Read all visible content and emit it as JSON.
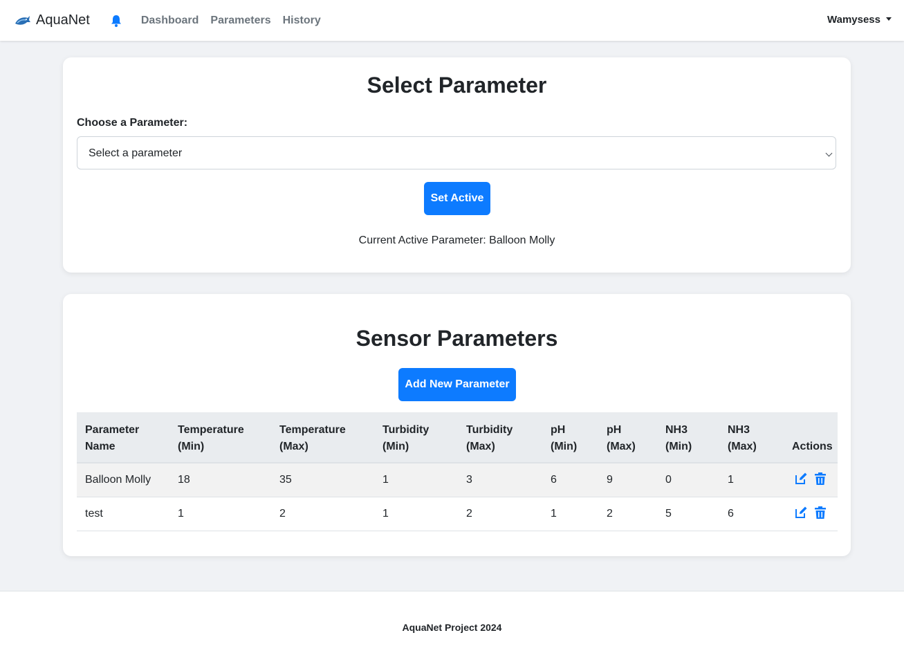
{
  "navbar": {
    "brand": "AquaNet",
    "logo_icon": "fish-logo-icon",
    "notification_icon": "bell-icon",
    "links": [
      "Dashboard",
      "Parameters",
      "History"
    ],
    "user": "Wamysess"
  },
  "select_card": {
    "title": "Select Parameter",
    "field_label": "Choose a Parameter:",
    "select_value": "Select a parameter",
    "button": "Set Active",
    "active_text": "Current Active Parameter: Balloon Molly"
  },
  "sensor_card": {
    "title": "Sensor Parameters",
    "add_button": "Add New Parameter",
    "columns": [
      [
        "Parameter",
        "Name"
      ],
      [
        "Temperature",
        "(Min)"
      ],
      [
        "Temperature",
        "(Max)"
      ],
      [
        "Turbidity",
        "(Min)"
      ],
      [
        "Turbidity",
        "(Max)"
      ],
      [
        "pH",
        "(Min)"
      ],
      [
        "pH",
        "(Max)"
      ],
      [
        "NH3",
        "(Min)"
      ],
      [
        "NH3",
        "(Max)"
      ],
      [
        "",
        "Actions"
      ]
    ],
    "rows": [
      [
        "Balloon Molly",
        "18",
        "35",
        "1",
        "3",
        "6",
        "9",
        "0",
        "1"
      ],
      [
        "test",
        "1",
        "2",
        "1",
        "2",
        "1",
        "2",
        "5",
        "6"
      ]
    ],
    "action_icons": [
      "edit-icon",
      "trash-icon"
    ]
  },
  "footer": {
    "text": "AquaNet Project 2024"
  },
  "colors": {
    "primary": "#0d7bff",
    "background": "#f0f2f5",
    "header_row": "#e9ecef"
  }
}
